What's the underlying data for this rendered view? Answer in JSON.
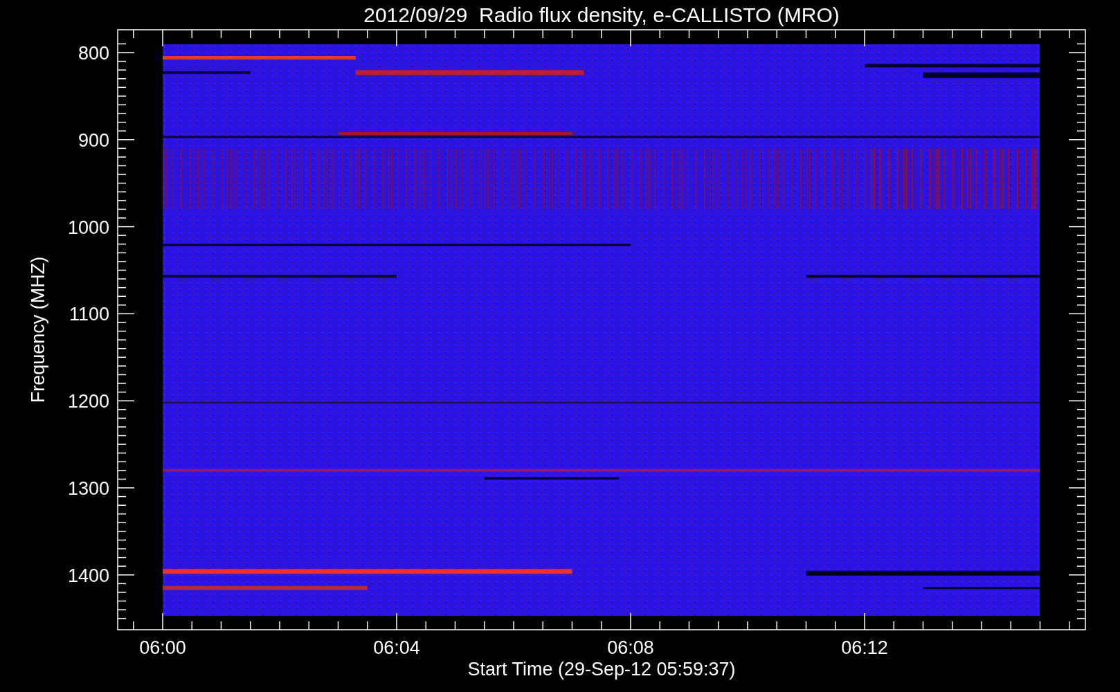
{
  "title": "2012/09/29  Radio flux density, e-CALLISTO (MRO)",
  "y_axis": {
    "label": "Frequency (MHZ)",
    "tick_labels": [
      "800",
      "900",
      "1000",
      "1100",
      "1200",
      "1300",
      "1400"
    ]
  },
  "x_axis": {
    "label": "Start Time (29-Sep-12 05:59:37)",
    "tick_labels": [
      "06:00",
      "06:04",
      "06:08",
      "06:12"
    ]
  }
}
